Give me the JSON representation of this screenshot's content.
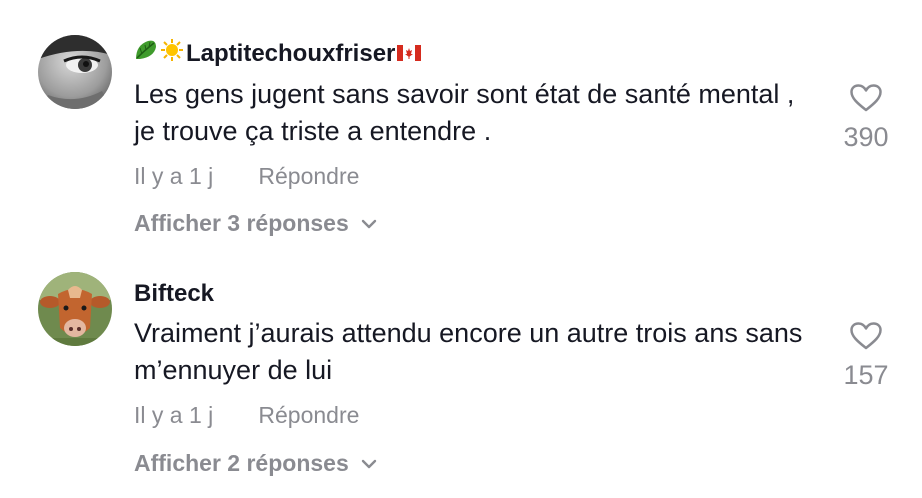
{
  "comments": [
    {
      "username": "Laptitechouxfriser",
      "text": "Les gens jugent sans savoir sont état de santé mental , je trouve ça triste a entendre .",
      "time": "Il y a 1 j",
      "reply_label": "Répondre",
      "view_replies": "Afficher 3 réponses",
      "likes": "390",
      "avatar": "woman-eye-photo",
      "username_emojis": [
        "leafy-green-emoji",
        "sun-emoji",
        "canada-flag-emoji"
      ]
    },
    {
      "username": "Bifteck",
      "text": "Vraiment j’aurais attendu encore un autre trois ans sans m’ennuyer de lui",
      "time": "Il y a 1 j",
      "reply_label": "Répondre",
      "view_replies": "Afficher 2 réponses",
      "likes": "157",
      "avatar": "cow-photo"
    }
  ]
}
